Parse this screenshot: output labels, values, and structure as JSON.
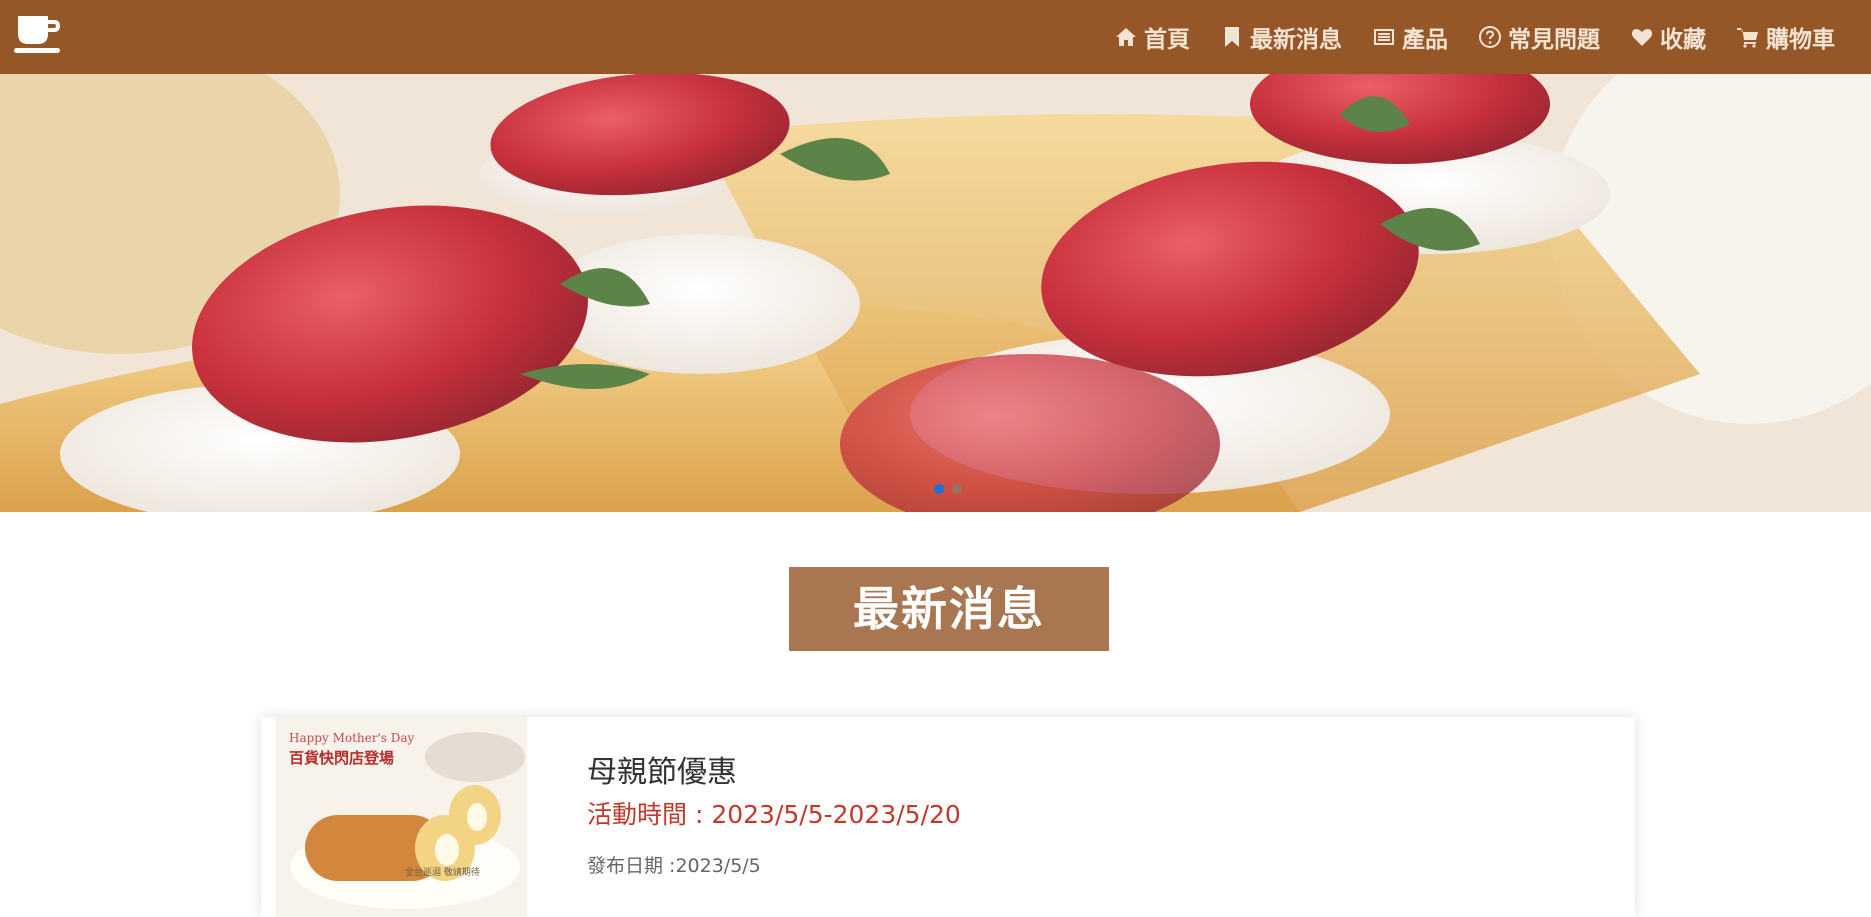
{
  "nav": {
    "items": [
      {
        "label": "首頁",
        "icon": "home-icon"
      },
      {
        "label": "最新消息",
        "icon": "bookmark-icon"
      },
      {
        "label": "產品",
        "icon": "list-icon"
      },
      {
        "label": "常見問題",
        "icon": "question-circle-icon"
      },
      {
        "label": "收藏",
        "icon": "heart-icon"
      },
      {
        "label": "購物車",
        "icon": "cart-icon"
      }
    ],
    "logo_icon": "coffee-cup-icon"
  },
  "carousel": {
    "slide_count": 2,
    "active_index": 0
  },
  "section": {
    "title": "最新消息"
  },
  "news": [
    {
      "thumb_tagline": "Happy Mother's Day",
      "thumb_heading": "百貨快閃店登場",
      "thumb_note": "全台巡迴 敬請期待",
      "title": "母親節優惠",
      "period": "活動時間 : 2023/5/5-2023/5/20",
      "published": "發布日期 :2023/5/5"
    }
  ],
  "colors": {
    "navbar": "#955628",
    "nav_text": "#f3e3d3",
    "section_title_bg": "#a87650",
    "period_text": "#c0392b",
    "carousel_active_dot": "#1e6fd9"
  }
}
